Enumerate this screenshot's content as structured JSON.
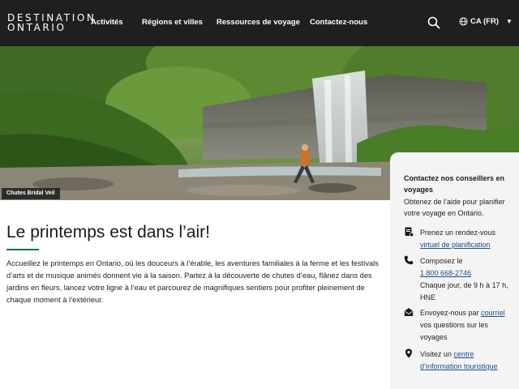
{
  "header": {
    "logo_line1": "DESTINATION",
    "logo_line2": "ONTARIO",
    "nav": [
      {
        "label": "Activités"
      },
      {
        "label": "Régions et villes"
      },
      {
        "label": "Ressources de voyage"
      },
      {
        "label": "Contactez-nous"
      }
    ],
    "search_icon": "search-icon",
    "lang_label": "CA (FR)",
    "lang_icon": "globe-icon"
  },
  "hero": {
    "caption": "Chutes Bridal Veil"
  },
  "main": {
    "title": "Le printemps est dans l’air!",
    "intro": "Accueillez le printemps en Ontario, où les douceurs à l’érable, les aventures familiales à la ferme et les festivals d’arts et de musique animés donnent vie à la saison. Partez à la découverte de chutes d’eau, flânez dans des jardins en fleurs, lancez votre ligne à l’eau et parcourez de magnifiques sentiers pour profiter pleinement de chaque moment à l’extérieur."
  },
  "contact_card": {
    "title": "Contactez nos conseillers en voyages",
    "subtitle": "Obtenez de l’aide pour planifier votre voyage en Ontario.",
    "items": [
      {
        "icon": "appointment-icon",
        "pre": "Prenez un rendez-vous",
        "link": "virtuel de planification",
        "post": ""
      },
      {
        "icon": "phone-icon",
        "pre": "Composez le",
        "link": "1 800 668-2746",
        "post": "Chaque jour, de 9 h à 17 h, HNE"
      },
      {
        "icon": "envelope-icon",
        "pre": "Envoyez-nous par",
        "link": "courriel",
        "post": "vos questions sur les voyages"
      },
      {
        "icon": "location-pin-icon",
        "pre": "Visitez un",
        "link": "centre d’information touristique",
        "post": ""
      }
    ]
  }
}
